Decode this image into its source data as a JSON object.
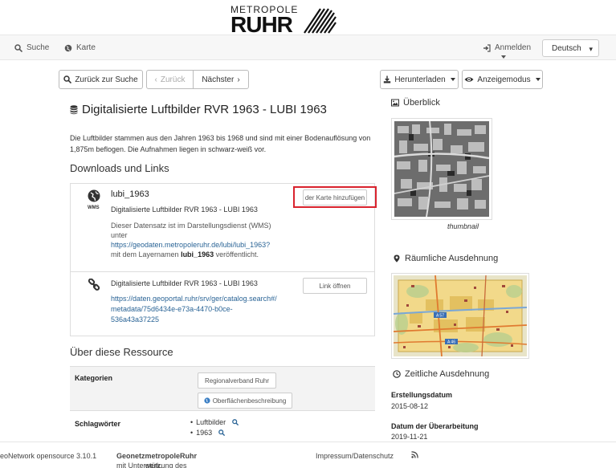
{
  "header": {
    "logo_top": "METROPOLE",
    "logo_main": "RUHR"
  },
  "nav": {
    "search": "Suche",
    "map": "Karte",
    "login": "Anmelden",
    "language": "Deutsch"
  },
  "toolbar": {
    "back_to_search": "Zurück zur Suche",
    "prev": "Zurück",
    "next": "Nächster",
    "download": "Herunterladen",
    "view_mode": "Anzeigemodus"
  },
  "record": {
    "title": "Digitalisierte Luftbilder RVR 1963 - LUBI 1963",
    "description": "Die Luftbilder stammen aus den Jahren 1963 bis 1968 und sind mit einer Bodenauflösung von 1,875m beflogen. Die Aufnahmen liegen in schwarz-weiß vor."
  },
  "downloads": {
    "heading": "Downloads und Links",
    "items": [
      {
        "badge": "WMS",
        "name": "lubi_1963",
        "title": "Digitalisierte Luftbilder RVR 1963 - LUBI 1963",
        "text1": "Dieser Datensatz ist im Darstellungsdienst (WMS)",
        "text2": "unter",
        "url": "https://geodaten.metropoleruhr.de/lubi/lubi_1963?",
        "text3_pre": "mit dem Layernamen",
        "layer": "lubi_1963",
        "text3_post": "veröffentlicht.",
        "button": "der Karte hinzufügen"
      },
      {
        "title": "Digitalisierte Luftbilder RVR 1963 - LUBI 1963",
        "url_line1": "https://daten.geoportal.ruhr/srv/ger/catalog.search#/",
        "url_line2": "metadata/75d6434e-e73a-4470-b0ce-",
        "url_line3": "536a43a37225",
        "button": "Link öffnen"
      }
    ]
  },
  "about": {
    "heading": "Über diese Ressource",
    "categories_label": "Kategorien",
    "categories": [
      "Regionalverband Ruhr",
      "Oberflächenbeschreibung"
    ],
    "keywords_label": "Schlagwörter",
    "keywords": [
      "Luftbilder",
      "1963"
    ]
  },
  "sidebar": {
    "overview": "Überblick",
    "thumb_caption": "thumbnail",
    "extent": "Räumliche Ausdehnung",
    "temporal": "Zeitliche Ausdehnung",
    "created_label": "Erstellungsdatum",
    "created": "2015-08-12",
    "revised_label": "Datum der Überarbeitung",
    "revised": "2019-11-21",
    "map_labels": {
      "a57": "A 57",
      "a46": "A 46"
    }
  },
  "footer": {
    "version": "eoNetwork opensource 3.10.1",
    "support_pre": "mit Unterstützung des",
    "support_b1": "Geonetz",
    "support_mid": "werk.",
    "support_b2": "metropoleRuhr",
    "imprint": "Impressum/Datenschutz"
  },
  "colors": {
    "highlight": "#d9232e",
    "link": "#2a6496"
  }
}
